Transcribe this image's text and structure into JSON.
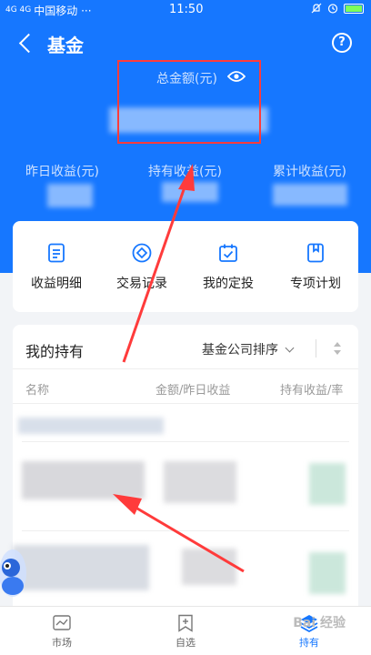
{
  "status_bar": {
    "signal": "4G 4G",
    "carrier": "中国移动 ···",
    "time": "11:50"
  },
  "nav": {
    "title": "基金",
    "help": "?"
  },
  "summary": {
    "total_label": "总金额(元)",
    "yesterday_label": "昨日收益(元)",
    "holding_label": "持有收益(元)",
    "cumulative_label": "累计收益(元)"
  },
  "actions": [
    {
      "label": "收益明细",
      "icon": "document-icon"
    },
    {
      "label": "交易记录",
      "icon": "diamond-record-icon"
    },
    {
      "label": "我的定投",
      "icon": "calendar-check-icon"
    },
    {
      "label": "专项计划",
      "icon": "bookmark-icon"
    }
  ],
  "holdings": {
    "title": "我的持有",
    "sort_label": "基金公司排序",
    "columns": [
      "名称",
      "金额/昨日收益",
      "持有收益/率"
    ]
  },
  "tabs": [
    {
      "label": "市场",
      "icon": "market-icon"
    },
    {
      "label": "自选",
      "icon": "watchlist-icon"
    },
    {
      "label": "持有",
      "icon": "holding-icon"
    }
  ],
  "watermark": "Bai 经验",
  "colors": {
    "brand_blue": "#1677ff",
    "annotation_red": "#ff3b3b"
  }
}
